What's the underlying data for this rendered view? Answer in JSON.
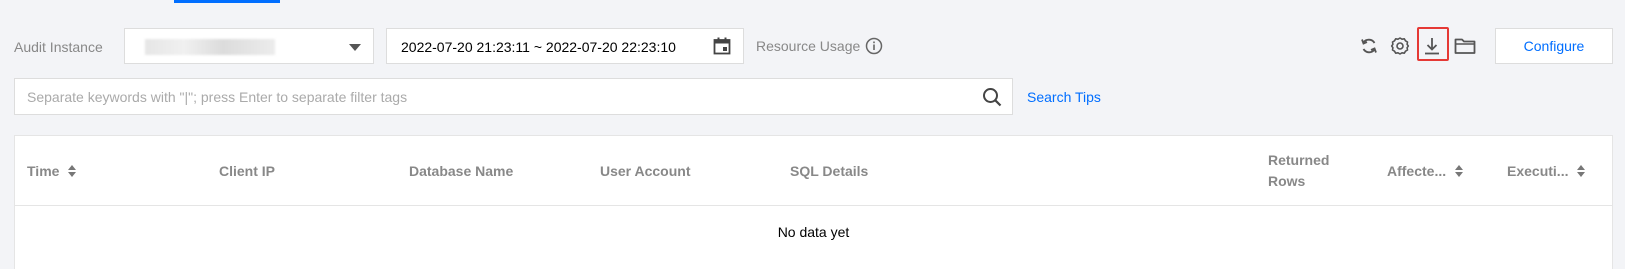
{
  "toolbar": {
    "audit_instance_label": "Audit Instance",
    "time_range": "2022-07-20 21:23:11 ~ 2022-07-20 22:23:10",
    "resource_usage_label": "Resource Usage",
    "configure_label": "Configure",
    "icons": [
      "refresh-icon",
      "gear-icon",
      "download-icon",
      "folder-icon"
    ],
    "highlight_color": "#e53935"
  },
  "search": {
    "placeholder": "Separate keywords with \"|\"; press Enter to separate filter tags",
    "tips_label": "Search Tips"
  },
  "table": {
    "columns": [
      {
        "label": "Time",
        "sortable": true
      },
      {
        "label": "Client IP",
        "sortable": false
      },
      {
        "label": "Database Name",
        "sortable": false
      },
      {
        "label": "User Account",
        "sortable": false
      },
      {
        "label": "SQL Details",
        "sortable": false
      },
      {
        "label": "Returned Rows",
        "sortable": false
      },
      {
        "label": "Affecte...",
        "sortable": true
      },
      {
        "label": "Executi...",
        "sortable": true
      }
    ],
    "empty_text": "No data yet"
  },
  "colors": {
    "accent": "#006eff",
    "background": "#f3f4f7"
  }
}
